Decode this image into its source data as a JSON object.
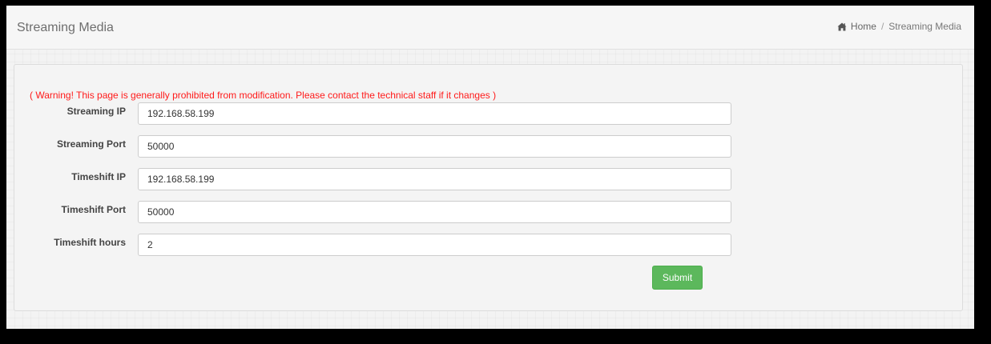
{
  "header": {
    "title": "Streaming Media",
    "breadcrumb": {
      "home_icon": "home-icon",
      "home_label": "Home",
      "separator": "/",
      "current": "Streaming Media"
    }
  },
  "form": {
    "warning": "( Warning! This page is generally prohibited from modification. Please contact the technical staff if it changes )",
    "fields": [
      {
        "label": "Streaming IP",
        "value": "192.168.58.199"
      },
      {
        "label": "Streaming Port",
        "value": "50000"
      },
      {
        "label": "Timeshift IP",
        "value": "192.168.58.199"
      },
      {
        "label": "Timeshift Port",
        "value": "50000"
      },
      {
        "label": "Timeshift hours",
        "value": "2"
      }
    ],
    "submit_label": "Submit"
  },
  "colors": {
    "warning": "#ff1a1a",
    "submit": "#5cb85c"
  }
}
